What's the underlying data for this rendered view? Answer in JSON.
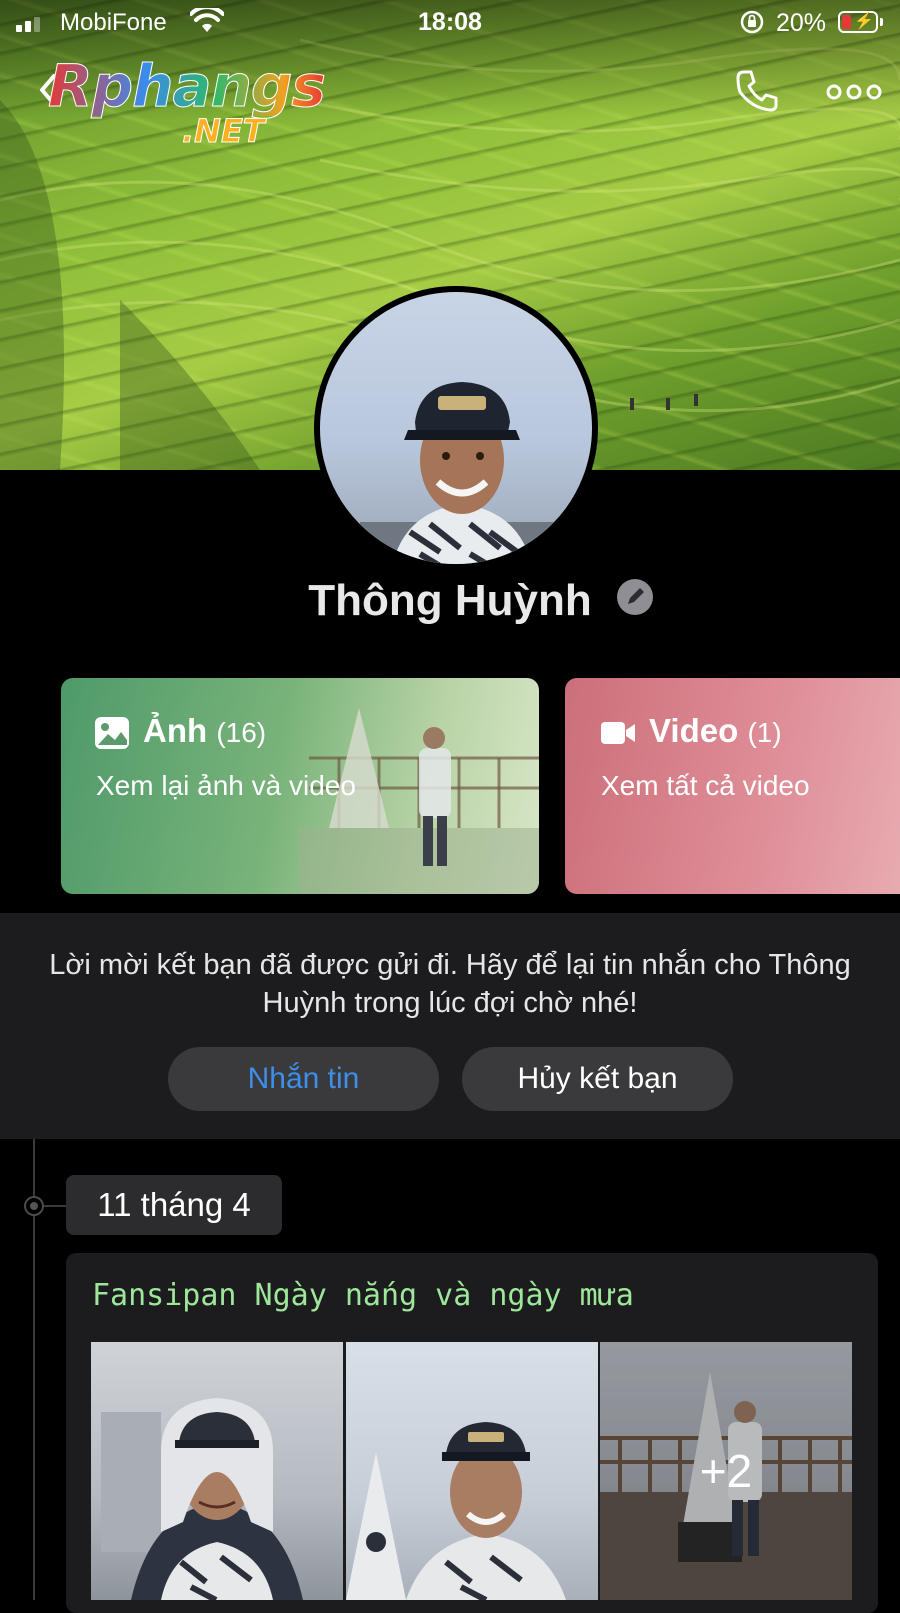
{
  "status_bar": {
    "carrier": "MobiFone",
    "time": "18:08",
    "battery_percent": "20%",
    "battery_level": 0.2
  },
  "header": {
    "logo_text": "Rphangs",
    "logo_suffix": ".NET"
  },
  "profile": {
    "name": "Thông Huỳnh"
  },
  "media": {
    "photos": {
      "label": "Ảnh",
      "count": "(16)",
      "subtitle": "Xem lại ảnh và video"
    },
    "videos": {
      "label": "Video",
      "count": "(1)",
      "subtitle": "Xem tất cả video"
    }
  },
  "friend_request": {
    "message": "Lời mời kết bạn đã được gửi đi. Hãy để lại tin nhắn cho Thông Huỳnh trong lúc đợi chờ nhé!",
    "message_button": "Nhắn tin",
    "unfriend_button": "Hủy kết bạn"
  },
  "timeline": {
    "date": "11 tháng 4",
    "post": {
      "title": "Fansipan Ngày nắng và ngày mưa",
      "more_photos": "+2"
    }
  },
  "colors": {
    "background": "#000000",
    "message_button_text": "#3d8fe9",
    "post_title": "#9ee79a",
    "photos_card": "#79b37a",
    "videos_card": "#e0909a",
    "panel": "#1c1c1e"
  },
  "icons": [
    "signal-icon",
    "wifi-icon",
    "orientation-lock-icon",
    "battery-icon",
    "back-icon",
    "phone-icon",
    "more-icon",
    "edit-icon",
    "image-icon",
    "video-camera-icon"
  ]
}
